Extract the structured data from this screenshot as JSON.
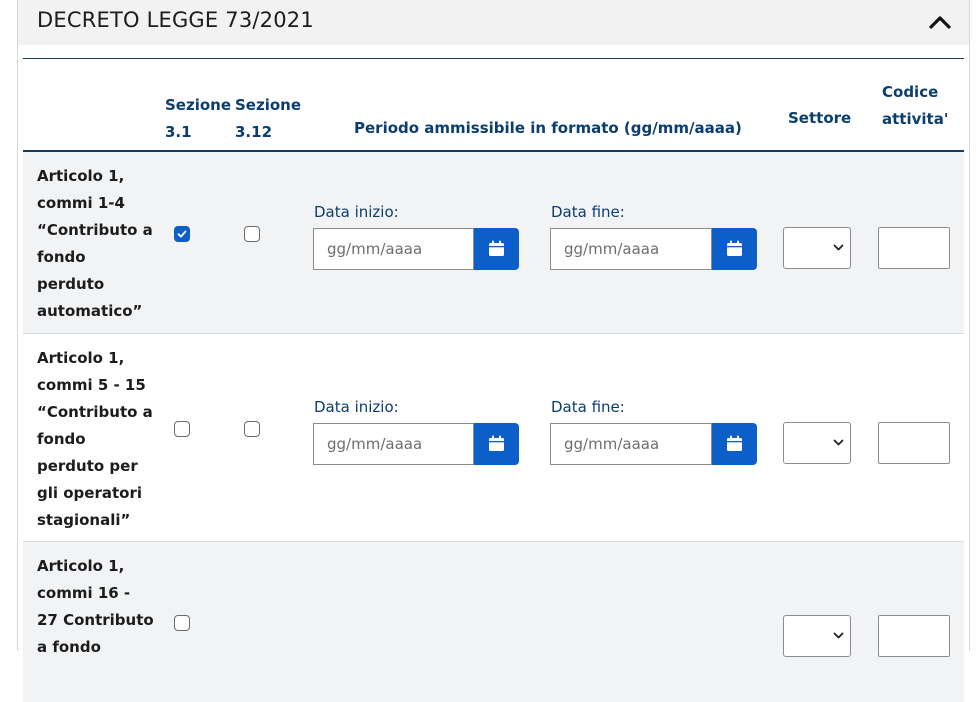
{
  "section": {
    "title": "DECRETO LEGGE 73/2021",
    "collapse_icon": "chevron-up-icon"
  },
  "table": {
    "headers": {
      "sez1_line1": "Sezione",
      "sez1_line2": "3.1",
      "sez2_line1": "Sezione",
      "sez2_line2": "3.12",
      "period": "Periodo ammissibile in formato (gg/mm/aaaa)",
      "settore": "Settore",
      "codice_line1": "Codice",
      "codice_line2": "attivita'"
    },
    "rows": [
      {
        "label_lines": [
          "Articolo 1,",
          "commi 1-4",
          "“Contributo a",
          "fondo",
          "perduto",
          "automatico”"
        ],
        "sez31_checked": true,
        "sez312_checked": false,
        "start_label": "Data inizio:",
        "start_placeholder": "gg/mm/aaaa",
        "end_label": "Data fine:",
        "end_placeholder": "gg/mm/aaaa",
        "settore": "",
        "codice": ""
      },
      {
        "label_lines": [
          "Articolo 1,",
          "commi 5 - 15",
          "“Contributo a",
          "fondo",
          "perduto per",
          "gli operatori",
          "stagionali”"
        ],
        "sez31_checked": false,
        "sez312_checked": false,
        "start_label": "Data inizio:",
        "start_placeholder": "gg/mm/aaaa",
        "end_label": "Data fine:",
        "end_placeholder": "gg/mm/aaaa",
        "settore": "",
        "codice": ""
      },
      {
        "label_lines": [
          "Articolo 1,",
          "commi 16 -",
          "27 Contributo",
          "a fondo"
        ],
        "sez31_checked": false,
        "settore": "",
        "codice": ""
      }
    ]
  },
  "colors": {
    "accent": "#0c5ec9",
    "header_text": "#0b3d6e",
    "rule": "#1b3a57"
  }
}
